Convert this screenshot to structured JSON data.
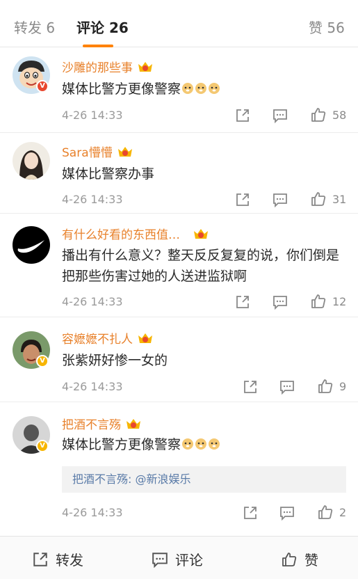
{
  "tabs": [
    {
      "label": "转发 6"
    },
    {
      "label": "评论 26"
    },
    {
      "label": "赞 56"
    }
  ],
  "comments": [
    {
      "name": "沙雕的那些事",
      "text": "媒体比警方更像警察",
      "time": "4-26 14:33",
      "likes": "58",
      "emoji": "doge-icon"
    },
    {
      "name": "Sara懵懵",
      "text": "媒体比警察办事",
      "time": "4-26 14:33",
      "likes": "31"
    },
    {
      "name": "有什么好看的东西值…",
      "text": "播出有什么意义？整天反反复复的说，你们倒是把那些伤害过她的人送进监狱啊",
      "time": "4-26 14:33",
      "likes": "12"
    },
    {
      "name": "容嬷嬷不扎人",
      "text": "张紫妍好惨一女的",
      "time": "4-26 14:33",
      "likes": "9"
    },
    {
      "name": "把酒不言殇",
      "text": "媒体比警方更像警察",
      "time": "4-26 14:33",
      "likes": "2",
      "emoji": "doge-icon",
      "quote_user": "把酒不言殇:",
      "quote_mention": " @新浪娱乐"
    }
  ],
  "bottom": {
    "repost": "转发",
    "comment": "评论",
    "like": "赞"
  },
  "colors": {
    "accent": "#ff8200",
    "name": "#e8812b",
    "link": "#5a7ba8",
    "vip_gold": "#f7b500",
    "vip_red": "#e8472f"
  }
}
